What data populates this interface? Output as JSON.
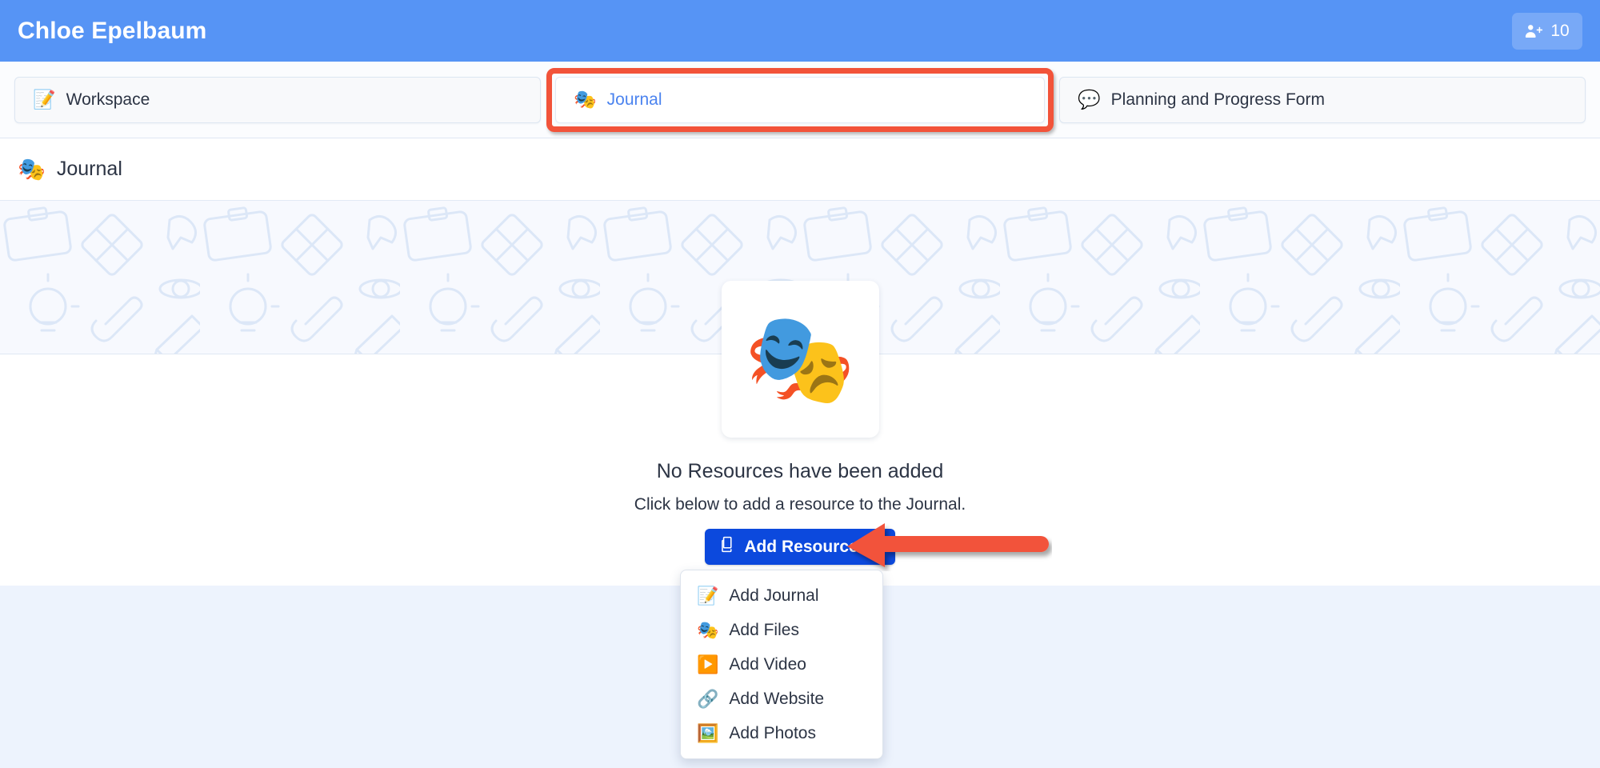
{
  "header": {
    "title": "Chloe Epelbaum",
    "members_badge": {
      "icon": "users-icon",
      "count": "10"
    },
    "background_color": "#5694f5"
  },
  "tabs": [
    {
      "icon": "memo-emoji",
      "emoji": "📝",
      "label": "Workspace",
      "active": false
    },
    {
      "icon": "performing-arts-emoji",
      "emoji": "🎭",
      "label": "Journal",
      "active": true,
      "highlighted": true
    },
    {
      "icon": "speech-balloon-emoji",
      "emoji": "💬",
      "label": "Planning and Progress Form",
      "active": false
    }
  ],
  "breadcrumb": {
    "emoji": "🎭",
    "label": "Journal"
  },
  "empty_state": {
    "emoji": "🎭",
    "title": "No Resources have been added",
    "subtitle": "Click below to add a resource to the Journal."
  },
  "add_resource_button": {
    "icon": "copy-icon",
    "label": "Add Resource",
    "caret": "chevron-down-icon",
    "color": "#0c49dd"
  },
  "dropdown_menu": {
    "items": [
      {
        "emoji": "📝",
        "icon": "memo-emoji",
        "label": "Add Journal"
      },
      {
        "emoji": "🎭",
        "icon": "performing-arts-emoji",
        "label": "Add Files"
      },
      {
        "emoji": "▶️",
        "icon": "play-button-emoji",
        "label": "Add Video"
      },
      {
        "emoji": "🔗",
        "icon": "link-emoji",
        "label": "Add Website"
      },
      {
        "emoji": "🖼️",
        "icon": "picture-emoji",
        "label": "Add Photos"
      }
    ]
  },
  "annotations": {
    "highlight_box_color": "#f2533a",
    "arrow": {
      "direction": "left",
      "color": "#f2533a",
      "points_to": "add-resource-button"
    }
  }
}
